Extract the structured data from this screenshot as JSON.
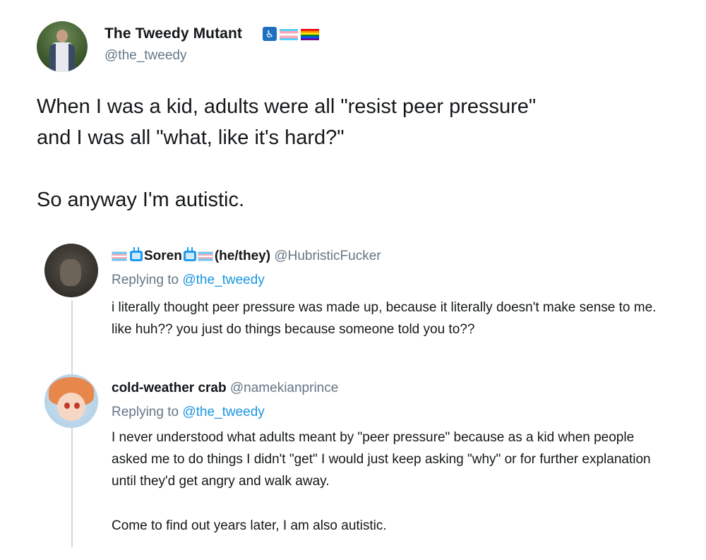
{
  "main_tweet": {
    "author_name": "The Tweedy Mutant",
    "handle": "@the_tweedy",
    "badges": [
      "disability-icon",
      "trans-flag",
      "rainbow-flag"
    ],
    "text_lines": [
      "When I was a kid, adults were all \"resist peer pressure\"",
      "and I was all \"what, like it's hard?\"",
      "So anyway I'm autistic."
    ]
  },
  "replies": [
    {
      "name": "Soren",
      "pronouns": "(he/they)",
      "handle": "@HubristicFucker",
      "name_decorations": [
        "trans-flag",
        "tv-icon",
        "tv-icon",
        "trans-flag"
      ],
      "replying_prefix": "Replying to",
      "replying_to": "@the_tweedy",
      "text": "i literally thought peer pressure was made up, because it literally doesn't make sense to me. like huh?? you just do things because someone told you to??"
    },
    {
      "name": "cold-weather crab",
      "handle": "@namekianprince",
      "replying_prefix": "Replying to",
      "replying_to": "@the_tweedy",
      "text": "I never understood what adults meant by \"peer pressure\" because as a kid when people asked me to do things I didn't \"get\" I would just keep asking \"why\" or for further explanation until they'd get angry and walk away.",
      "text_2": "Come to find out years later, I am also autistic."
    }
  ],
  "colors": {
    "text": "#14171a",
    "secondary": "#657786",
    "link": "#1b95e0",
    "thread_line": "#d3d9de"
  }
}
